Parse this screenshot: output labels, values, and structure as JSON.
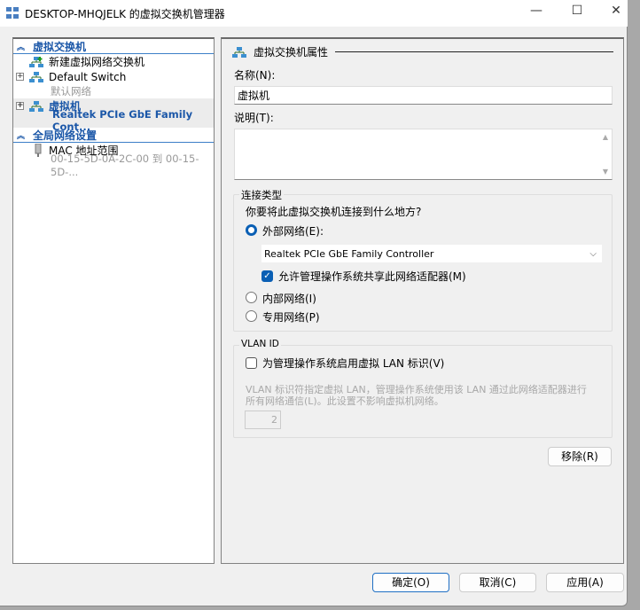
{
  "window": {
    "title": "DESKTOP-MHQJELK 的虚拟交换机管理器",
    "minimize": "—",
    "maximize": "☐",
    "close": "✕"
  },
  "sidebar": {
    "section1": "虚拟交换机",
    "new_switch": "新建虚拟网络交换机",
    "switches": [
      {
        "name": "Default Switch",
        "sub": "默认网络"
      },
      {
        "name": "虚拟机",
        "sub": "Realtek PCIe GbE Family Cont..."
      }
    ],
    "section2": "全局网络设置",
    "mac_label": "MAC 地址范围",
    "mac_range": "00-15-5D-0A-2C-00 到 00-15-5D-..."
  },
  "props": {
    "header": "虚拟交换机属性",
    "name_label": "名称(N):",
    "name_value": "虚拟机",
    "desc_label": "说明(T):",
    "desc_value": "",
    "conn_group": "连接类型",
    "conn_question": "你要将此虚拟交换机连接到什么地方?",
    "external": "外部网络(E):",
    "adapter": "Realtek PCIe GbE Family Controller",
    "allow_share": "允许管理操作系统共享此网络适配器(M)",
    "internal": "内部网络(I)",
    "private": "专用网络(P)",
    "vlan_group": "VLAN ID",
    "vlan_enable": "为管理操作系统启用虚拟 LAN 标识(V)",
    "vlan_desc1": "VLAN 标识符指定虚拟 LAN，管理操作系统使用该 LAN 通过此网络适配器进行",
    "vlan_desc2": "所有网络通信(L)。此设置不影响虚拟机网络。",
    "vlan_value": "2",
    "remove": "移除(R)"
  },
  "footer": {
    "ok": "确定(O)",
    "cancel": "取消(C)",
    "apply": "应用(A)"
  },
  "colors": {
    "accent": "#0a5fb4",
    "section": "#1b57a8"
  }
}
